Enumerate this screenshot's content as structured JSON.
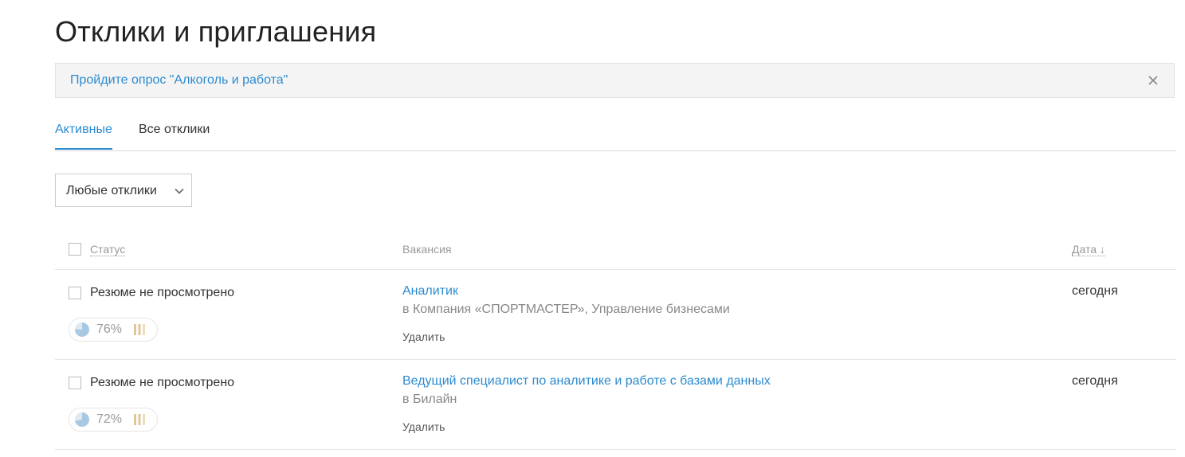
{
  "page": {
    "title": "Отклики и приглашения"
  },
  "banner": {
    "link_text": "Пройдите опрос \"Алкоголь и работа\"",
    "close_icon": "close-icon"
  },
  "tabs": [
    {
      "label": "Активные",
      "active": true
    },
    {
      "label": "Все отклики",
      "active": false
    }
  ],
  "filter": {
    "selected": "Любые отклики",
    "icon": "chevron-down-icon"
  },
  "table": {
    "headers": {
      "status": "Статус",
      "vacancy": "Вакансия",
      "date": "Дата ↓"
    },
    "rows": [
      {
        "status": "Резюме не просмотрено",
        "match_pct": "76%",
        "match_value": 0.76,
        "vacancy_title": "Аналитик",
        "company": "в Компания «СПОРТМАСТЕР», Управление бизнесами",
        "delete_label": "Удалить",
        "date": "сегодня"
      },
      {
        "status": "Резюме не просмотрено",
        "match_pct": "72%",
        "match_value": 0.72,
        "vacancy_title": "Ведущий специалист по аналитике и работе с базами данных",
        "company": "в Билайн",
        "delete_label": "Удалить",
        "date": "сегодня"
      }
    ]
  },
  "colors": {
    "accent": "#2b8bd0",
    "pie_fill": "#a9c8e2",
    "bars_fill": "#e0c79a"
  }
}
